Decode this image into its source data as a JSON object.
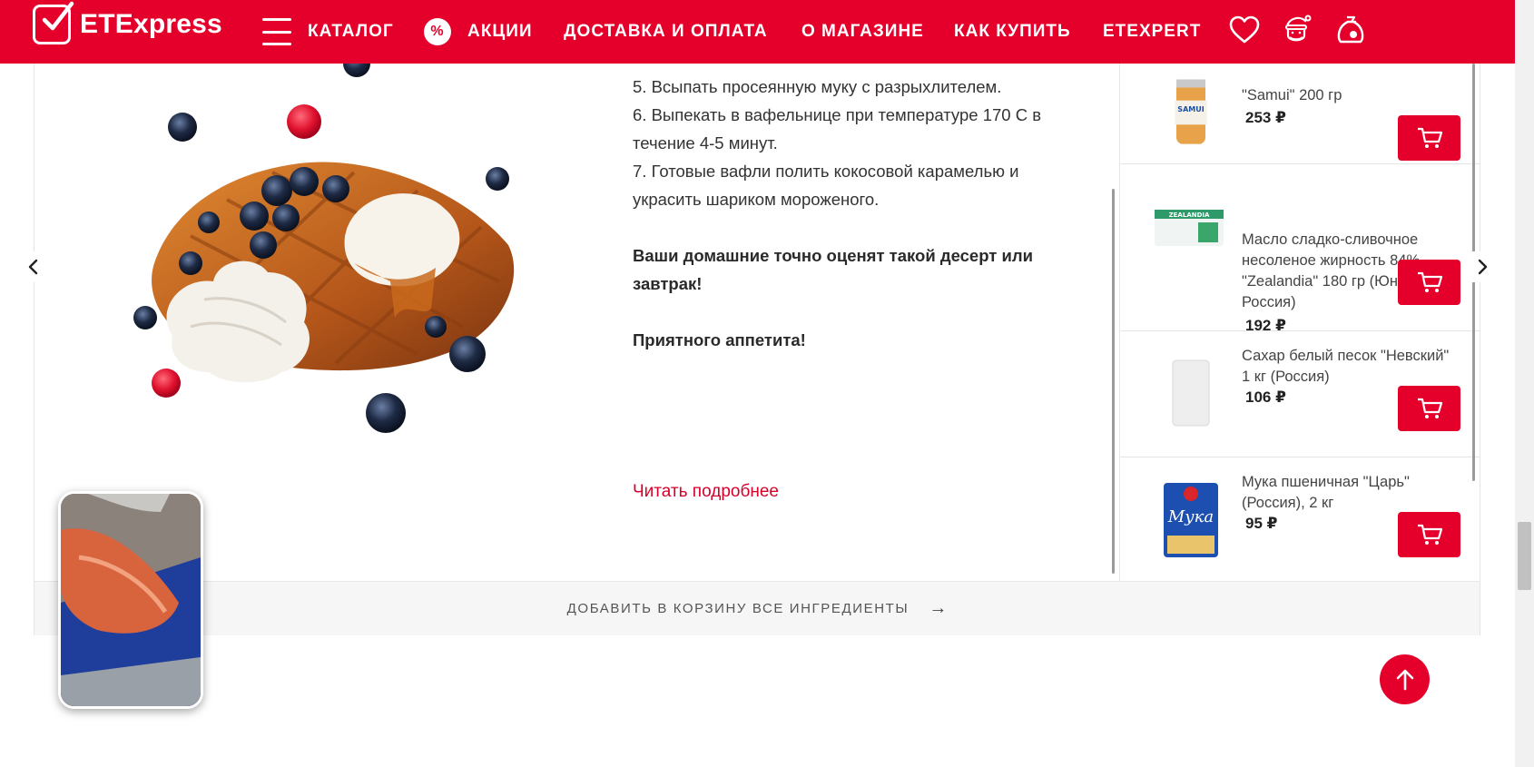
{
  "header": {
    "logo_text": "ETExpress",
    "nav": {
      "catalog": "КАТАЛОГ",
      "sales": "АКЦИИ",
      "sales_icon": "%",
      "delivery": "ДОСТАВКА И ОПЛАТА",
      "about": "О МАГАЗИНЕ",
      "how_to_buy": "КАК КУПИТЬ",
      "etexpert": "ETEXPERT"
    },
    "icons": [
      "heart-icon",
      "santa-icon",
      "gift-bag-icon"
    ]
  },
  "recipe": {
    "steps": [
      "5. Всыпать просеянную муку с разрыхлителем.",
      "6. Выпекать в вафельнице при температуре 170 С в течение 4-5 минут.",
      "7. Готовые вафли полить кокосовой карамелью и украсить шариком мороженого."
    ],
    "note": "Ваши домашние точно оценят такой десерт или завтрак!",
    "closing": "Приятного аппетита!",
    "read_more": "Читать подробнее"
  },
  "ingredients": [
    {
      "name": "\"Samui\" 200 гр",
      "price": "253 ₽"
    },
    {
      "name": "Масло сладко-сливочное несоленое жирность 84% \"Zealandia\" 180 гр (Юнифуд, Россия)",
      "price": "192 ₽"
    },
    {
      "name": "Сахар белый песок \"Невский\" 1 кг (Россия)",
      "price": "106 ₽"
    },
    {
      "name": "Мука пшеничная \"Царь\" (Россия), 2 кг",
      "price": "95 ₽"
    }
  ],
  "product_labels": {
    "samui": "SAMUI",
    "zealandia": "ZEALANDIA",
    "flour": "Мука"
  },
  "add_all": "ДОБАВИТЬ В КОРЗИНУ ВСЕ ИНГРЕДИЕНТЫ",
  "add_all_arrow": "→",
  "colors": {
    "brand": "#e4002b",
    "link": "#d6002a"
  }
}
